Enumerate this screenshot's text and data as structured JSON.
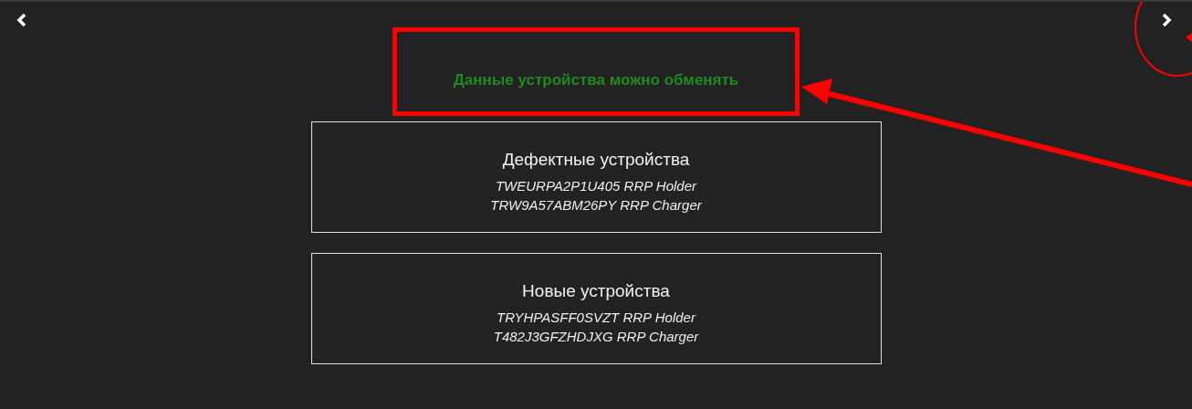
{
  "message": "Данные устройства можно обменять",
  "groups": [
    {
      "title": "Дефектные устройства",
      "items": [
        "TWEURPA2P1U405 RRP Holder",
        "TRW9A57ABM26PY RRP Charger"
      ]
    },
    {
      "title": "Новые устройства",
      "items": [
        "TRYHPASFF0SVZT RRP Holder",
        "T482J3GFZHDJXG RRP Charger"
      ]
    }
  ]
}
